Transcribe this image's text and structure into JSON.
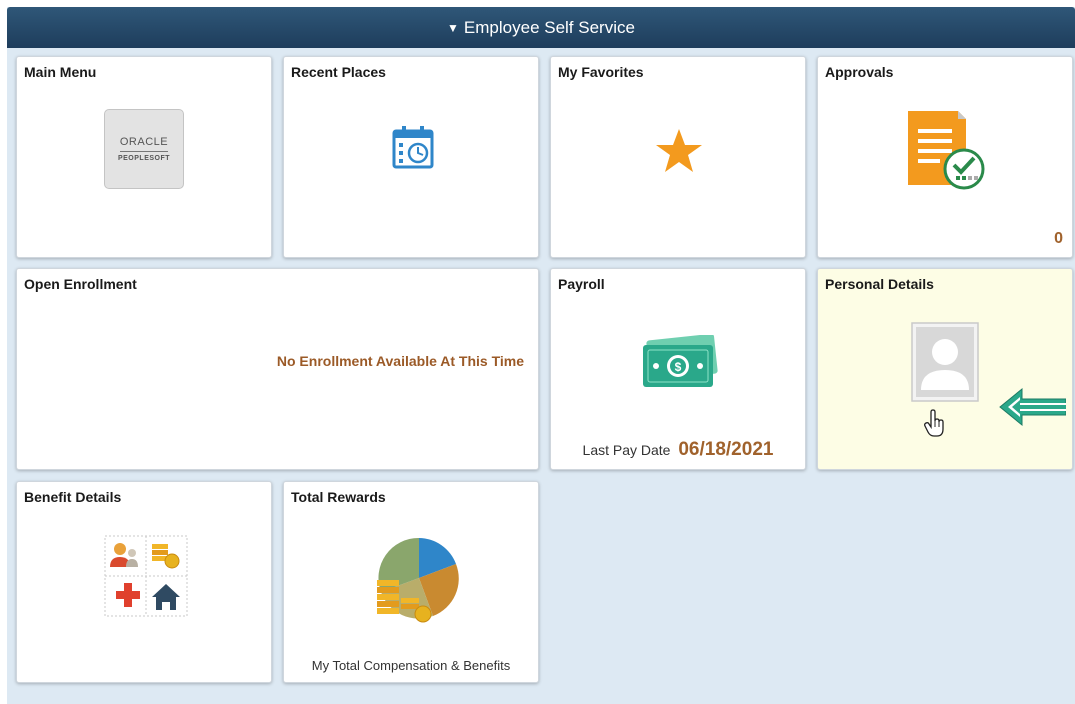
{
  "header": {
    "caret": "▼",
    "title": "Employee Self Service"
  },
  "tiles": {
    "main_menu": {
      "title": "Main Menu",
      "logo_line1": "ORACLE",
      "logo_line2": "PEOPLESOFT"
    },
    "recent_places": {
      "title": "Recent Places",
      "icon": "calendar-clock-icon"
    },
    "my_favorites": {
      "title": "My Favorites",
      "icon": "star-icon"
    },
    "approvals": {
      "title": "Approvals",
      "icon": "document-check-icon",
      "count": "0"
    },
    "open_enrollment": {
      "title": "Open Enrollment",
      "message": "No Enrollment Available At This Time"
    },
    "payroll": {
      "title": "Payroll",
      "icon": "money-icon",
      "last_pay_label": "Last Pay Date",
      "last_pay_date": "06/18/2021"
    },
    "personal_details": {
      "title": "Personal Details",
      "icon": "person-placeholder-icon"
    },
    "benefit_details": {
      "title": "Benefit Details",
      "icon": "benefits-grid-icon"
    },
    "total_rewards": {
      "title": "Total Rewards",
      "icon": "pie-coins-icon",
      "label": "My Total Compensation & Benefits"
    }
  },
  "colors": {
    "banner": "#2a4d6e",
    "background": "#dde9f3",
    "accent_value": "#a0622c",
    "highlight_tile": "#fdfde5",
    "annotation_arrow": "#2aa88a"
  }
}
